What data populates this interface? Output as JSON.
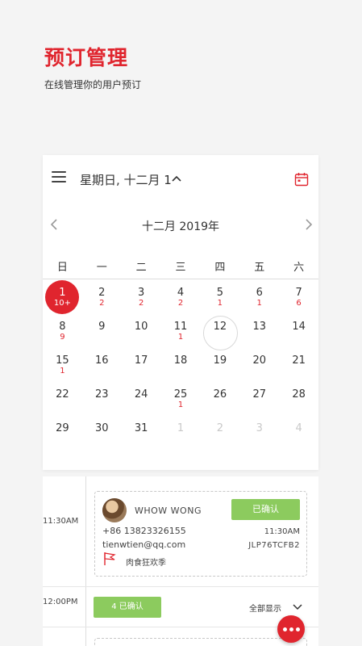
{
  "header": {
    "title": "预订管理",
    "subtitle": "在线管理你的用户预订"
  },
  "calendar": {
    "selected_date_title": "星期日, 十二月 1",
    "month_label": "十二月 2019年",
    "weekdays": [
      "日",
      "一",
      "二",
      "三",
      "四",
      "五",
      "六"
    ],
    "weeks": [
      [
        {
          "day": "1",
          "count": "10+",
          "state": "selected"
        },
        {
          "day": "2",
          "count": "2"
        },
        {
          "day": "3",
          "count": "2"
        },
        {
          "day": "4",
          "count": "2"
        },
        {
          "day": "5",
          "count": "1"
        },
        {
          "day": "6",
          "count": "1"
        },
        {
          "day": "7",
          "count": "6"
        }
      ],
      [
        {
          "day": "8",
          "count": "9"
        },
        {
          "day": "9",
          "count": ""
        },
        {
          "day": "10",
          "count": ""
        },
        {
          "day": "11",
          "count": "1"
        },
        {
          "day": "12",
          "count": "",
          "state": "today"
        },
        {
          "day": "13",
          "count": ""
        },
        {
          "day": "14",
          "count": ""
        }
      ],
      [
        {
          "day": "15",
          "count": "1"
        },
        {
          "day": "16",
          "count": ""
        },
        {
          "day": "17",
          "count": ""
        },
        {
          "day": "18",
          "count": ""
        },
        {
          "day": "19",
          "count": ""
        },
        {
          "day": "20",
          "count": ""
        },
        {
          "day": "21",
          "count": ""
        }
      ],
      [
        {
          "day": "22",
          "count": ""
        },
        {
          "day": "23",
          "count": ""
        },
        {
          "day": "24",
          "count": ""
        },
        {
          "day": "25",
          "count": "1"
        },
        {
          "day": "26",
          "count": ""
        },
        {
          "day": "27",
          "count": ""
        },
        {
          "day": "28",
          "count": ""
        }
      ],
      [
        {
          "day": "29",
          "count": ""
        },
        {
          "day": "30",
          "count": ""
        },
        {
          "day": "31",
          "count": ""
        },
        {
          "day": "1",
          "count": "",
          "state": "muted"
        },
        {
          "day": "2",
          "count": "",
          "state": "muted"
        },
        {
          "day": "3",
          "count": "",
          "state": "muted"
        },
        {
          "day": "4",
          "count": "",
          "state": "muted"
        }
      ]
    ]
  },
  "schedule": {
    "slots": [
      {
        "time": "11:30AM"
      },
      {
        "time": "12:00PM"
      }
    ],
    "booking": {
      "guest_name": "WHOW WONG",
      "status": "已确认",
      "phone": "+86 13823326155",
      "email": "tienwtien@qq.com",
      "time": "11:30AM",
      "code": "JLP76TCFB2",
      "event": "肉食狂欢季"
    },
    "confirmed_summary": "4 已确认",
    "show_all": "全部显示"
  },
  "colors": {
    "accent": "#e0252e",
    "confirm_green": "#8ccb5e"
  }
}
